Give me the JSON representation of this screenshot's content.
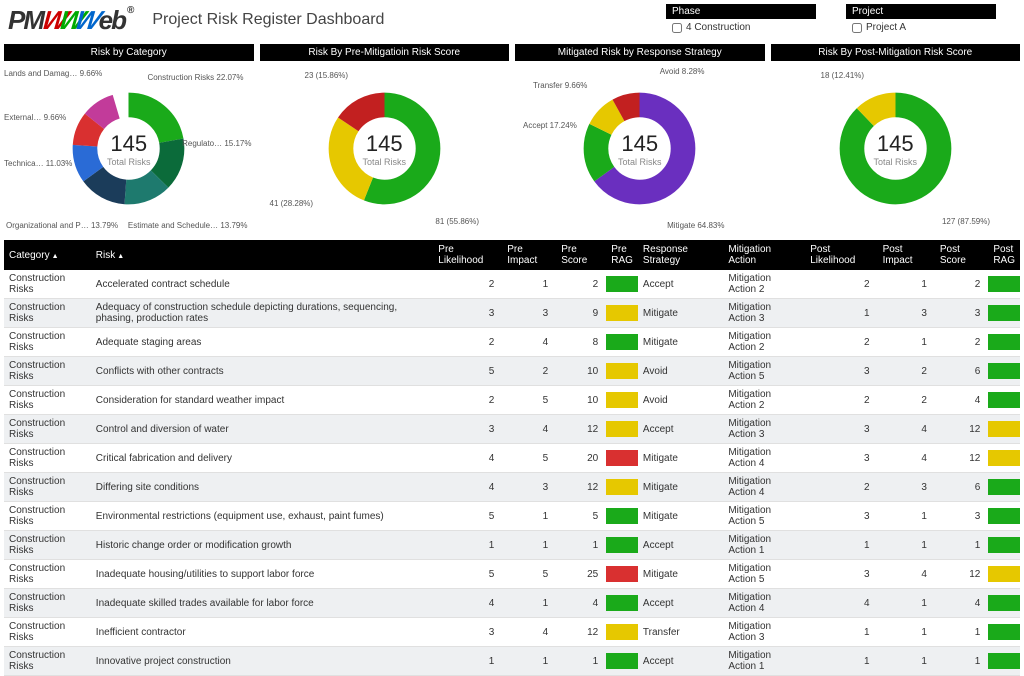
{
  "logo_text": "PMWeb",
  "title": "Project Risk Register Dashboard",
  "filters": {
    "phase": {
      "label": "Phase",
      "value": "4 Construction"
    },
    "project": {
      "label": "Project",
      "value": "Project A"
    }
  },
  "charts": [
    {
      "title": "Risk by Category",
      "total": "145",
      "total_label": "Total Risks"
    },
    {
      "title": "Risk By Pre-Mitigatioin Risk Score",
      "total": "145",
      "total_label": "Total Risks"
    },
    {
      "title": "Mitigated Risk by Response Strategy",
      "total": "145",
      "total_label": "Total Risks"
    },
    {
      "title": "Risk By Post-Mitigation Risk Score",
      "total": "145",
      "total_label": "Total Risks"
    }
  ],
  "chart_data": [
    {
      "type": "pie",
      "title": "Risk by Category",
      "series": [
        {
          "name": "Construction Risks",
          "pct": 22.07,
          "color": "#1aaa1a"
        },
        {
          "name": "Regulato…",
          "pct": 15.17,
          "color": "#0b6b3a"
        },
        {
          "name": "Estimate and Schedule…",
          "pct": 13.79,
          "color": "#1e7a6e"
        },
        {
          "name": "Organizational and P…",
          "pct": 13.79,
          "color": "#1b3c5a"
        },
        {
          "name": "Technica…",
          "pct": 11.03,
          "color": "#2a6bd6"
        },
        {
          "name": "External…",
          "pct": 9.66,
          "color": "#d93030"
        },
        {
          "name": "Lands and Damag…",
          "pct": 9.66,
          "color": "#c23b9a"
        }
      ]
    },
    {
      "type": "pie",
      "title": "Risk By Pre-Mitigatioin Risk Score",
      "series": [
        {
          "name": "81 (55.86%)",
          "pct": 55.86,
          "color": "#1aaa1a"
        },
        {
          "name": "41 (28.28%)",
          "pct": 28.28,
          "color": "#e6c800"
        },
        {
          "name": "23 (15.86%)",
          "pct": 15.86,
          "color": "#c22020"
        }
      ]
    },
    {
      "type": "pie",
      "title": "Mitigated Risk by Response Strategy",
      "series": [
        {
          "name": "Mitigate",
          "pct": 64.83,
          "color": "#6a2fbf"
        },
        {
          "name": "Accept",
          "pct": 17.24,
          "color": "#1aaa1a"
        },
        {
          "name": "Transfer",
          "pct": 9.66,
          "color": "#e6c800"
        },
        {
          "name": "Avoid",
          "pct": 8.28,
          "color": "#c22020"
        }
      ]
    },
    {
      "type": "pie",
      "title": "Risk By Post-Mitigation Risk Score",
      "series": [
        {
          "name": "127 (87.59%)",
          "pct": 87.59,
          "color": "#1aaa1a"
        },
        {
          "name": "18 (12.41%)",
          "pct": 12.41,
          "color": "#e6c800"
        }
      ]
    }
  ],
  "chart_labels": {
    "c0": {
      "construction": "Construction Risks\n22.07%",
      "regulato": "Regulato…\n15.17%",
      "estimate": "Estimate and Schedule…\n13.79%",
      "org": "Organizational and P…\n13.79%",
      "tech": "Technica…\n11.03%",
      "external": "External…\n9.66%",
      "lands": "Lands and Damag…\n9.66%"
    },
    "c1": {
      "a": "81 (55.86%)",
      "b": "41 (28.28%)",
      "c": "23 (15.86%)"
    },
    "c2": {
      "mitigate": "Mitigate 64.83%",
      "accept": "Accept\n17.24%",
      "transfer": "Transfer\n9.66%",
      "avoid": "Avoid 8.28%"
    },
    "c3": {
      "a": "127 (87.59%)",
      "b": "18 (12.41%)"
    }
  },
  "table": {
    "headers": [
      "Category",
      "Risk",
      "Pre Likelihood",
      "Pre Impact",
      "Pre Score",
      "Pre RAG",
      "Response Strategy",
      "Mitigation Action",
      "Post Likelihood",
      "Post Impact",
      "Post Score",
      "Post RAG"
    ],
    "rows": [
      {
        "cat": "Construction Risks",
        "risk": "Accelerated contract schedule",
        "pl": "2",
        "pi": "1",
        "ps": "2",
        "prag": "green",
        "rs": "Accept",
        "ma": "Mitigation Action 2",
        "pol": "2",
        "poi": "1",
        "pos": "2",
        "porag": "green"
      },
      {
        "cat": "Construction Risks",
        "risk": "Adequacy of construction schedule depicting durations, sequencing, phasing, production rates",
        "pl": "3",
        "pi": "3",
        "ps": "9",
        "prag": "yellow",
        "rs": "Mitigate",
        "ma": "Mitigation Action 3",
        "pol": "1",
        "poi": "3",
        "pos": "3",
        "porag": "green"
      },
      {
        "cat": "Construction Risks",
        "risk": "Adequate staging areas",
        "pl": "2",
        "pi": "4",
        "ps": "8",
        "prag": "green",
        "rs": "Mitigate",
        "ma": "Mitigation Action 2",
        "pol": "2",
        "poi": "1",
        "pos": "2",
        "porag": "green"
      },
      {
        "cat": "Construction Risks",
        "risk": "Conflicts with other contracts",
        "pl": "5",
        "pi": "2",
        "ps": "10",
        "prag": "yellow",
        "rs": "Avoid",
        "ma": "Mitigation Action 5",
        "pol": "3",
        "poi": "2",
        "pos": "6",
        "porag": "green"
      },
      {
        "cat": "Construction Risks",
        "risk": "Consideration for standard weather impact",
        "pl": "2",
        "pi": "5",
        "ps": "10",
        "prag": "yellow",
        "rs": "Avoid",
        "ma": "Mitigation Action 2",
        "pol": "2",
        "poi": "2",
        "pos": "4",
        "porag": "green"
      },
      {
        "cat": "Construction Risks",
        "risk": "Control and diversion of water",
        "pl": "3",
        "pi": "4",
        "ps": "12",
        "prag": "yellow",
        "rs": "Accept",
        "ma": "Mitigation Action 3",
        "pol": "3",
        "poi": "4",
        "pos": "12",
        "porag": "yellow"
      },
      {
        "cat": "Construction Risks",
        "risk": "Critical fabrication and delivery",
        "pl": "4",
        "pi": "5",
        "ps": "20",
        "prag": "red",
        "rs": "Mitigate",
        "ma": "Mitigation Action 4",
        "pol": "3",
        "poi": "4",
        "pos": "12",
        "porag": "yellow"
      },
      {
        "cat": "Construction Risks",
        "risk": "Differing site conditions",
        "pl": "4",
        "pi": "3",
        "ps": "12",
        "prag": "yellow",
        "rs": "Mitigate",
        "ma": "Mitigation Action 4",
        "pol": "2",
        "poi": "3",
        "pos": "6",
        "porag": "green"
      },
      {
        "cat": "Construction Risks",
        "risk": "Environmental restrictions (equipment use, exhaust, paint fumes)",
        "pl": "5",
        "pi": "1",
        "ps": "5",
        "prag": "green",
        "rs": "Mitigate",
        "ma": "Mitigation Action 5",
        "pol": "3",
        "poi": "1",
        "pos": "3",
        "porag": "green"
      },
      {
        "cat": "Construction Risks",
        "risk": "Historic change order or modification growth",
        "pl": "1",
        "pi": "1",
        "ps": "1",
        "prag": "green",
        "rs": "Accept",
        "ma": "Mitigation Action 1",
        "pol": "1",
        "poi": "1",
        "pos": "1",
        "porag": "green"
      },
      {
        "cat": "Construction Risks",
        "risk": "Inadequate housing/utilities to support labor force",
        "pl": "5",
        "pi": "5",
        "ps": "25",
        "prag": "red",
        "rs": "Mitigate",
        "ma": "Mitigation Action 5",
        "pol": "3",
        "poi": "4",
        "pos": "12",
        "porag": "yellow"
      },
      {
        "cat": "Construction Risks",
        "risk": "Inadequate skilled trades available for labor force",
        "pl": "4",
        "pi": "1",
        "ps": "4",
        "prag": "green",
        "rs": "Accept",
        "ma": "Mitigation Action 4",
        "pol": "4",
        "poi": "1",
        "pos": "4",
        "porag": "green"
      },
      {
        "cat": "Construction Risks",
        "risk": "Inefficient contractor",
        "pl": "3",
        "pi": "4",
        "ps": "12",
        "prag": "yellow",
        "rs": "Transfer",
        "ma": "Mitigation Action 3",
        "pol": "1",
        "poi": "1",
        "pos": "1",
        "porag": "green"
      },
      {
        "cat": "Construction Risks",
        "risk": "Innovative project construction",
        "pl": "1",
        "pi": "1",
        "ps": "1",
        "prag": "green",
        "rs": "Accept",
        "ma": "Mitigation Action 1",
        "pol": "1",
        "poi": "1",
        "pos": "1",
        "porag": "green"
      }
    ]
  }
}
